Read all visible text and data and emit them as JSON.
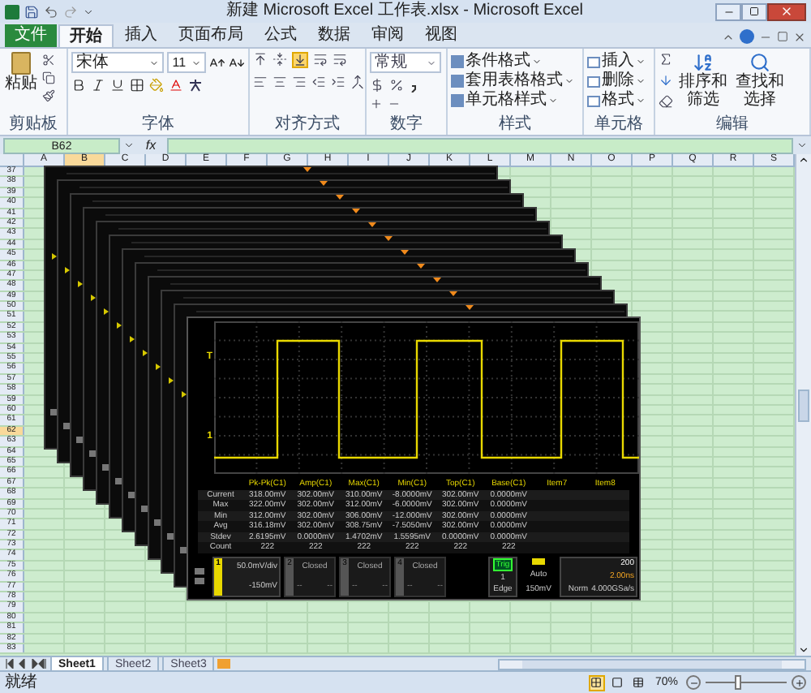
{
  "window": {
    "title": "新建 Microsoft Excel 工作表.xlsx - Microsoft Excel"
  },
  "ribbon_tabs": [
    {
      "label": "文件",
      "kind": "file",
      "selected": false
    },
    {
      "label": "开始",
      "kind": "tab",
      "selected": true
    },
    {
      "label": "插入",
      "kind": "tab",
      "selected": false
    },
    {
      "label": "页面布局",
      "kind": "tab",
      "selected": false
    },
    {
      "label": "公式",
      "kind": "tab",
      "selected": false
    },
    {
      "label": "数据",
      "kind": "tab",
      "selected": false
    },
    {
      "label": "审阅",
      "kind": "tab",
      "selected": false
    },
    {
      "label": "视图",
      "kind": "tab",
      "selected": false
    }
  ],
  "ribbon": {
    "clipboard": {
      "paste": "粘贴",
      "label": "剪贴板"
    },
    "font": {
      "name": "宋体",
      "size": "11",
      "label": "字体"
    },
    "alignment": {
      "label": "对齐方式"
    },
    "number": {
      "format": "常规",
      "label": "数字"
    },
    "styles": {
      "items": [
        "条件格式",
        "套用表格格式",
        "单元格样式"
      ],
      "label": "样式"
    },
    "cells": {
      "items": [
        "插入",
        "删除",
        "格式"
      ],
      "label": "单元格"
    },
    "editing": {
      "sort": "排序和筛选",
      "find": "查找和选择",
      "label": "编辑"
    }
  },
  "formula_bar": {
    "name_box": "B62",
    "function_label": "fx"
  },
  "columns": [
    {
      "label": "A",
      "selected": false
    },
    {
      "label": "B",
      "selected": true
    },
    {
      "label": "C",
      "selected": false
    },
    {
      "label": "D",
      "selected": false
    },
    {
      "label": "E",
      "selected": false
    },
    {
      "label": "F",
      "selected": false
    },
    {
      "label": "G",
      "selected": false
    },
    {
      "label": "H",
      "selected": false
    },
    {
      "label": "I",
      "selected": false
    },
    {
      "label": "J",
      "selected": false
    },
    {
      "label": "K",
      "selected": false
    },
    {
      "label": "L",
      "selected": false
    },
    {
      "label": "M",
      "selected": false
    },
    {
      "label": "N",
      "selected": false
    },
    {
      "label": "O",
      "selected": false
    },
    {
      "label": "P",
      "selected": false
    },
    {
      "label": "Q",
      "selected": false
    },
    {
      "label": "R",
      "selected": false
    },
    {
      "label": "S",
      "selected": false
    }
  ],
  "rows": [
    {
      "label": "37",
      "selected": false
    },
    {
      "label": "38",
      "selected": false
    },
    {
      "label": "39",
      "selected": false
    },
    {
      "label": "40",
      "selected": false
    },
    {
      "label": "41",
      "selected": false
    },
    {
      "label": "42",
      "selected": false
    },
    {
      "label": "43",
      "selected": false
    },
    {
      "label": "44",
      "selected": false
    },
    {
      "label": "45",
      "selected": false
    },
    {
      "label": "46",
      "selected": false
    },
    {
      "label": "47",
      "selected": false
    },
    {
      "label": "48",
      "selected": false
    },
    {
      "label": "49",
      "selected": false
    },
    {
      "label": "50",
      "selected": false
    },
    {
      "label": "51",
      "selected": false
    },
    {
      "label": "52",
      "selected": false
    },
    {
      "label": "53",
      "selected": false
    },
    {
      "label": "54",
      "selected": false
    },
    {
      "label": "55",
      "selected": false
    },
    {
      "label": "56",
      "selected": false
    },
    {
      "label": "57",
      "selected": false
    },
    {
      "label": "58",
      "selected": false
    },
    {
      "label": "59",
      "selected": false
    },
    {
      "label": "60",
      "selected": false
    },
    {
      "label": "61",
      "selected": false
    },
    {
      "label": "62",
      "selected": true
    },
    {
      "label": "63",
      "selected": false
    },
    {
      "label": "64",
      "selected": false
    },
    {
      "label": "65",
      "selected": false
    },
    {
      "label": "66",
      "selected": false
    },
    {
      "label": "67",
      "selected": false
    },
    {
      "label": "68",
      "selected": false
    },
    {
      "label": "69",
      "selected": false
    },
    {
      "label": "70",
      "selected": false
    },
    {
      "label": "71",
      "selected": false
    },
    {
      "label": "72",
      "selected": false
    },
    {
      "label": "73",
      "selected": false
    },
    {
      "label": "74",
      "selected": false
    },
    {
      "label": "75",
      "selected": false
    },
    {
      "label": "76",
      "selected": false
    },
    {
      "label": "77",
      "selected": false
    },
    {
      "label": "78",
      "selected": false
    },
    {
      "label": "79",
      "selected": false
    },
    {
      "label": "80",
      "selected": false
    },
    {
      "label": "81",
      "selected": false
    },
    {
      "label": "82",
      "selected": false
    },
    {
      "label": "83",
      "selected": false
    }
  ],
  "scope": {
    "trigger_marker": "T",
    "channel_marker": "1",
    "measurements": {
      "columns": [
        "Pk-Pk(C1)",
        "Amp(C1)",
        "Max(C1)",
        "Min(C1)",
        "Top(C1)",
        "Base(C1)",
        "Item7",
        "Item8"
      ],
      "rows": [
        {
          "label": "Current",
          "values": [
            "318.00mV",
            "302.00mV",
            "310.00mV",
            "-8.0000mV",
            "302.00mV",
            "0.0000mV"
          ]
        },
        {
          "label": "Max",
          "values": [
            "322.00mV",
            "302.00mV",
            "312.00mV",
            "-6.0000mV",
            "302.00mV",
            "0.0000mV"
          ]
        },
        {
          "label": "Min",
          "values": [
            "312.00mV",
            "302.00mV",
            "306.00mV",
            "-12.000mV",
            "302.00mV",
            "0.0000mV"
          ]
        },
        {
          "label": "Avg",
          "values": [
            "316.18mV",
            "302.00mV",
            "308.75mV",
            "-7.5050mV",
            "302.00mV",
            "0.0000mV"
          ]
        },
        {
          "label": "Stdev",
          "values": [
            "2.6195mV",
            "0.0000mV",
            "1.4702mV",
            "1.5595mV",
            "0.0000mV",
            "0.0000mV"
          ]
        },
        {
          "label": "Count",
          "values": [
            "222",
            "222",
            "222",
            "222",
            "222",
            "222"
          ]
        }
      ]
    },
    "channels": [
      {
        "number": "1",
        "kind": "active",
        "scale": "50.0mV/div",
        "offset": "-150mV"
      },
      {
        "number": "2",
        "kind": "closed",
        "status": "Closed",
        "readings": [
          "--",
          "--"
        ]
      },
      {
        "number": "3",
        "kind": "closed",
        "status": "Closed",
        "readings": [
          "--",
          "--"
        ]
      },
      {
        "number": "4",
        "kind": "closed",
        "status": "Closed",
        "readings": [
          "--",
          "--"
        ]
      }
    ],
    "trigger": {
      "label": "Trig",
      "source": "1",
      "type": "Edge",
      "mode": "Auto",
      "trigger_level": "150mV"
    },
    "timebase": {
      "scale": "200",
      "delay": "2.00ns",
      "mode": "Norm",
      "sample_rate": "4.000GSa/s"
    }
  },
  "sheet_tabs": [
    {
      "label": "Sheet1",
      "selected": true
    },
    {
      "label": "Sheet2",
      "selected": false
    },
    {
      "label": "Sheet3",
      "selected": false
    }
  ],
  "status_bar": {
    "status": "就绪",
    "views": [
      {
        "kind": "normal",
        "selected": true
      },
      {
        "kind": "page_layout",
        "selected": false
      },
      {
        "kind": "page_break",
        "selected": false
      }
    ],
    "zoom": "70%",
    "zoom_slider": {
      "level": 0.4
    }
  }
}
